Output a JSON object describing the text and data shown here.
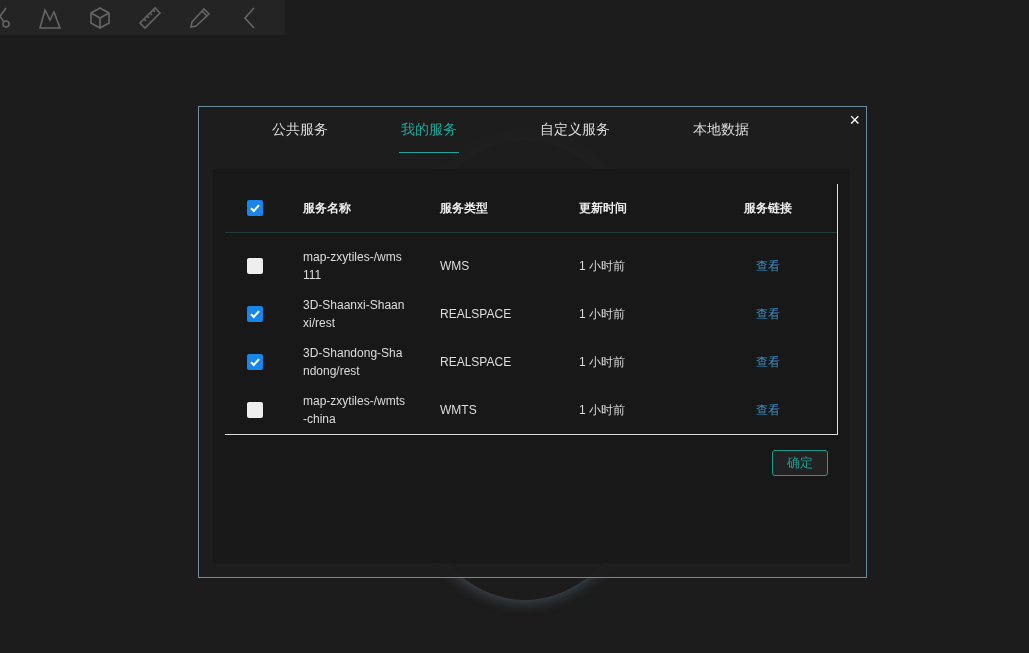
{
  "dialog": {
    "tabs": [
      {
        "label": "公共服务",
        "selected": false
      },
      {
        "label": "我的服务",
        "selected": true
      },
      {
        "label": "自定义服务",
        "selected": false
      },
      {
        "label": "本地数据",
        "selected": false
      }
    ],
    "close": "×",
    "table": {
      "all_checked": true,
      "columns": [
        "服务名称",
        "服务类型",
        "更新时间",
        "服务链接"
      ],
      "rows": [
        {
          "checked": false,
          "name": "map-zxytiles-/wms111",
          "type": "WMS",
          "updated": "1 小时前",
          "link": "查看"
        },
        {
          "checked": true,
          "name": "3D-Shaanxi-Shaanxi/rest",
          "type": "REALSPACE",
          "updated": "1 小时前",
          "link": "查看"
        },
        {
          "checked": true,
          "name": "3D-Shandong-Shandong/rest",
          "type": "REALSPACE",
          "updated": "1 小时前",
          "link": "查看"
        },
        {
          "checked": false,
          "name": "map-zxytiles-/wmts-china",
          "type": "WMTS",
          "updated": "1 小时前",
          "link": "查看"
        }
      ]
    },
    "confirm": "确定"
  }
}
